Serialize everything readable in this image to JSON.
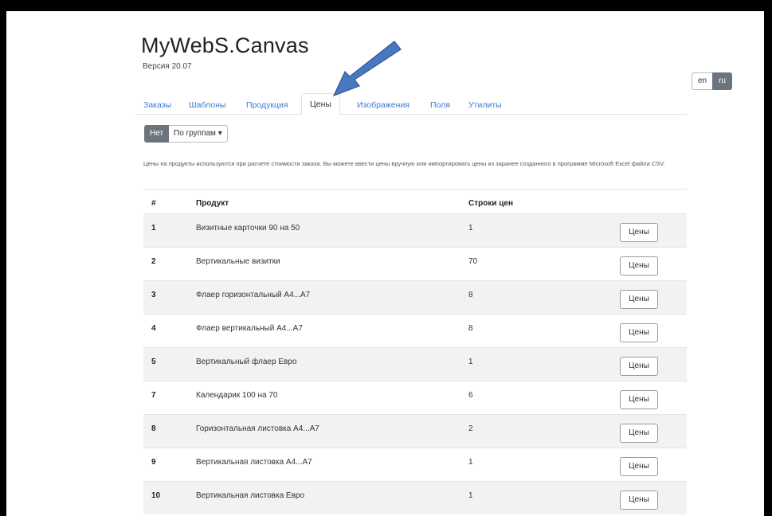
{
  "app": {
    "title": "MyWebS.Canvas",
    "version": "Версия 20.07"
  },
  "lang": {
    "en": "en",
    "ru": "ru"
  },
  "tabs": [
    {
      "label": "Заказы"
    },
    {
      "label": "Шаблоны"
    },
    {
      "label": "Продукция"
    },
    {
      "label": "Цены",
      "active": true
    },
    {
      "label": "Изображения"
    },
    {
      "label": "Поля"
    },
    {
      "label": "Утилиты"
    }
  ],
  "filter": {
    "no_label": "Нет",
    "groups_label": "По группам ▾"
  },
  "description": "Цены на продукты используются при расчете стоимости заказа. Вы можете ввести цены вручную или импортировать цены из заранее созданного в программе Microsoft Excel файла CSV.",
  "table": {
    "headers": {
      "num": "#",
      "product": "Продукт",
      "rows": "Строки цен"
    },
    "rows": [
      {
        "num": "1",
        "product": "Визитные карточки 90 на 50",
        "count": "1",
        "button": "Цены"
      },
      {
        "num": "2",
        "product": "Вертикальные визитки",
        "count": "70",
        "button": "Цены"
      },
      {
        "num": "3",
        "product": "Флаер горизонтальный А4...А7",
        "count": "8",
        "button": "Цены"
      },
      {
        "num": "4",
        "product": "Флаер вертикальный А4...А7",
        "count": "8",
        "button": "Цены"
      },
      {
        "num": "5",
        "product": "Вертикальный флаер Евро",
        "count": "1",
        "button": "Цены"
      },
      {
        "num": "7",
        "product": "Календарик 100 на 70",
        "count": "6",
        "button": "Цены"
      },
      {
        "num": "8",
        "product": "Горизонтальная листовка А4...А7",
        "count": "2",
        "button": "Цены"
      },
      {
        "num": "9",
        "product": "Вертикальная листовка А4...А7",
        "count": "1",
        "button": "Цены"
      },
      {
        "num": "10",
        "product": "Вертикальная листовка Евро",
        "count": "1",
        "button": "Цены"
      }
    ]
  },
  "colors": {
    "accent": "#3a7bd5",
    "annotation_arrow": "#4a78c0"
  }
}
